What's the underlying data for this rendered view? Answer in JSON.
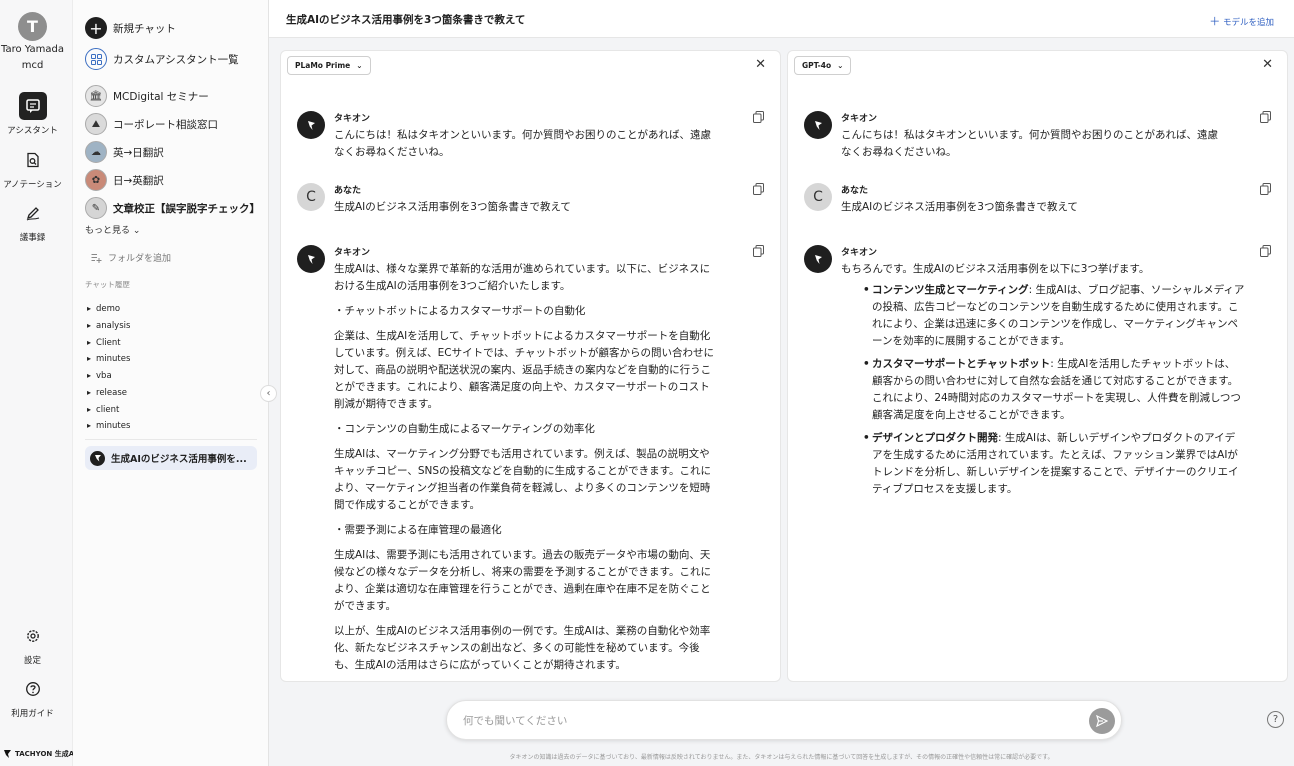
{
  "user": {
    "initial": "T",
    "name": "Taro Yamada",
    "org": "mcd"
  },
  "rail": {
    "assistant": "アシスタント",
    "annotation": "アノテーション",
    "minutes": "議事録",
    "settings": "設定",
    "guide": "利用ガイド",
    "brand": "TACHYON 生成AI"
  },
  "sidebar": {
    "new_chat": "新規チャット",
    "custom_list": "カスタムアシスタント一覧",
    "assistants": [
      "MCDigital セミナー",
      "コーポレート相談窓口",
      "英→日翻訳",
      "日→英翻訳",
      "文章校正【誤字脱字チェック】"
    ],
    "more": "もっと見る",
    "add_folder": "フォルダを追加",
    "history_title": "チャット履歴",
    "folders": [
      "demo",
      "analysis",
      "Client",
      "minutes",
      "vba",
      "release",
      "client",
      "minutes"
    ],
    "active_chat": "生成AIのビジネス活用事例を..."
  },
  "header": {
    "title": "生成AIのビジネス活用事例を3つ箇条書きで教えて",
    "add_model": "モデルを追加"
  },
  "left_panel": {
    "model": "PLaMo Prime",
    "bot_name": "タキオン",
    "user_name": "あなた",
    "user_initial": "C",
    "greeting": "こんにちは！私はタキオンといいます。何か質問やお困りのことがあれば、遠慮なくお尋ねくださいね。",
    "question": "生成AIのビジネス活用事例を3つ箇条書きで教えて",
    "answer": [
      "生成AIは、様々な業界で革新的な活用が進められています。以下に、ビジネスにおける生成AIの活用事例を3つご紹介いたします。",
      "・チャットボットによるカスタマーサポートの自動化",
      "企業は、生成AIを活用して、チャットボットによるカスタマーサポートを自動化しています。例えば、ECサイトでは、チャットボットが顧客からの問い合わせに対して、商品の説明や配送状況の案内、返品手続きの案内などを自動的に行うことができます。これにより、顧客満足度の向上や、カスタマーサポートのコスト削減が期待できます。",
      "・コンテンツの自動生成によるマーケティングの効率化",
      "生成AIは、マーケティング分野でも活用されています。例えば、製品の説明文やキャッチコピー、SNSの投稿文などを自動的に生成することができます。これにより、マーケティング担当者の作業負荷を軽減し、より多くのコンテンツを短時間で作成することができます。",
      "・需要予測による在庫管理の最適化",
      "生成AIは、需要予測にも活用されています。過去の販売データや市場の動向、天候などの様々なデータを分析し、将来の需要を予測することができます。これにより、企業は適切な在庫管理を行うことができ、過剰在庫や在庫不足を防ぐことができます。",
      "以上が、生成AIのビジネス活用事例の一例です。生成AIは、業務の自動化や効率化、新たなビジネスチャンスの創出など、多くの可能性を秘めています。今後も、生成AIの活用はさらに広がっていくことが期待されます。"
    ]
  },
  "right_panel": {
    "model": "GPT-4o",
    "bot_name": "タキオン",
    "user_name": "あなた",
    "user_initial": "C",
    "greeting": "こんにちは！私はタキオンといいます。何か質問やお困りのことがあれば、遠慮なくお尋ねくださいね。",
    "question": "生成AIのビジネス活用事例を3つ箇条書きで教えて",
    "intro": "もちろんです。生成AIのビジネス活用事例を以下に3つ挙げます。",
    "bullets": [
      {
        "title": "コンテンツ生成とマーケティング",
        "body": ": 生成AIは、ブログ記事、ソーシャルメディアの投稿、広告コピーなどのコンテンツを自動生成するために使用されます。これにより、企業は迅速に多くのコンテンツを作成し、マーケティングキャンペーンを効率的に展開することができます。"
      },
      {
        "title": "カスタマーサポートとチャットボット",
        "body": ": 生成AIを活用したチャットボットは、顧客からの問い合わせに対して自然な会話を通じて対応することができます。これにより、24時間対応のカスタマーサポートを実現し、人件費を削減しつつ顧客満足度を向上させることができます。"
      },
      {
        "title": "デザインとプロダクト開発",
        "body": ": 生成AIは、新しいデザインやプロダクトのアイデアを生成するために活用されています。たとえば、ファッション業界ではAIがトレンドを分析し、新しいデザインを提案することで、デザイナーのクリエイティブプロセスを支援します。"
      }
    ]
  },
  "input": {
    "placeholder": "何でも聞いてください"
  },
  "footer": {
    "disclaimer": "タキオンの知識は過去のデータに基づいており、最新情報は反映されておりません。また、タキオンは与えられた情報に基づいて回答を生成しますが、その情報の正確性や信頼性は常に確認が必要です。"
  },
  "colors": {
    "accent": "#2f5fc1",
    "active_bg": "#e9edf7",
    "dark": "#1f1f1f"
  }
}
